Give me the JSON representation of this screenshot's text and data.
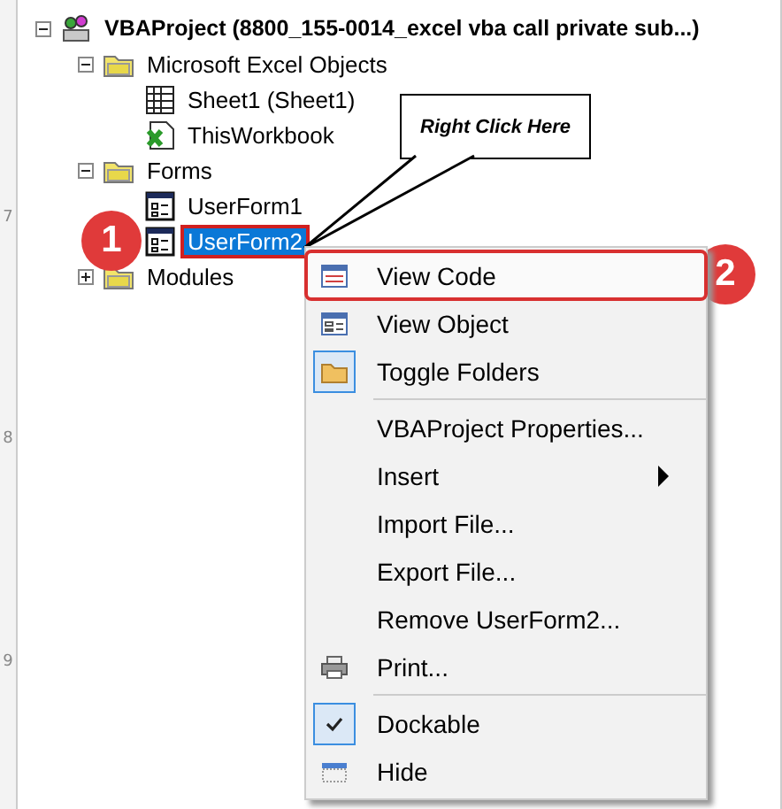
{
  "ruler_marks": [
    "7",
    "8",
    "9"
  ],
  "tree": [
    {
      "label": "VBAProject (8800_155-0014_excel vba call private sub...)",
      "kind": "project",
      "expanded": true,
      "selected": false,
      "children": [
        {
          "label": "Microsoft Excel Objects",
          "kind": "folder",
          "expanded": true,
          "selected": false,
          "children": [
            {
              "label": "Sheet1 (Sheet1)",
              "kind": "sheet",
              "selected": false
            },
            {
              "label": "ThisWorkbook",
              "kind": "workbook",
              "selected": false
            }
          ]
        },
        {
          "label": "Forms",
          "kind": "folder",
          "expanded": true,
          "selected": false,
          "children": [
            {
              "label": "UserForm1",
              "kind": "form",
              "selected": false
            },
            {
              "label": "UserForm2",
              "kind": "form",
              "selected": true
            }
          ]
        },
        {
          "label": "Modules",
          "kind": "folder",
          "expanded": false,
          "selected": false
        }
      ]
    }
  ],
  "callout": "Right Click Here",
  "badges": [
    "1",
    "2"
  ],
  "menu": [
    {
      "label": "View Code",
      "kind": "code",
      "checked": false,
      "outlined": true,
      "submenu": false,
      "separator_after": false
    },
    {
      "label": "View Object",
      "kind": "object",
      "checked": false,
      "outlined": false,
      "submenu": false,
      "separator_after": false
    },
    {
      "label": "Toggle Folders",
      "kind": "folder",
      "checked": true,
      "outlined": false,
      "submenu": false,
      "separator_after": true
    },
    {
      "label": "VBAProject Properties...",
      "kind": "plain",
      "checked": false,
      "outlined": false,
      "submenu": false,
      "separator_after": false
    },
    {
      "label": "Insert",
      "kind": "plain",
      "checked": false,
      "outlined": false,
      "submenu": true,
      "separator_after": false
    },
    {
      "label": "Import File...",
      "kind": "plain",
      "checked": false,
      "outlined": false,
      "submenu": false,
      "separator_after": false
    },
    {
      "label": "Export File...",
      "kind": "plain",
      "checked": false,
      "outlined": false,
      "submenu": false,
      "separator_after": false
    },
    {
      "label": "Remove UserForm2...",
      "kind": "plain",
      "checked": false,
      "outlined": false,
      "submenu": false,
      "separator_after": false
    },
    {
      "label": "Print...",
      "kind": "printer",
      "checked": false,
      "outlined": false,
      "submenu": false,
      "separator_after": true
    },
    {
      "label": "Dockable",
      "kind": "check",
      "checked": true,
      "outlined": false,
      "submenu": false,
      "separator_after": false
    },
    {
      "label": "Hide",
      "kind": "hide",
      "checked": false,
      "outlined": false,
      "submenu": false,
      "separator_after": false
    }
  ]
}
